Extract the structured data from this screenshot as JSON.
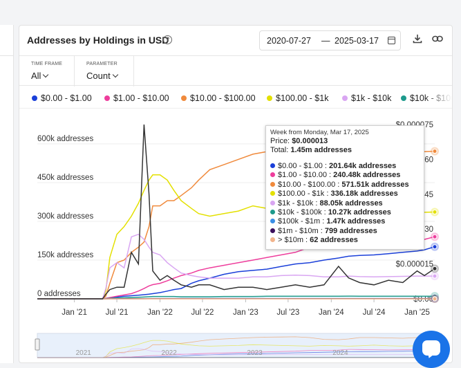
{
  "header": {
    "title": "Addresses by Holdings in USD",
    "help_icon": "?",
    "date_start": "2020-07-27",
    "date_sep": "—",
    "date_end": "2025-03-17",
    "icons": [
      "calendar-icon",
      "download-icon",
      "link-icon"
    ]
  },
  "controls": {
    "time_frame_label": "TIME FRAME",
    "time_frame_value": "All",
    "parameter_label": "PARAMETER",
    "parameter_value": "Count"
  },
  "tooltip": {
    "week": "Week from Monday, Mar 17, 2025",
    "price_label": "Price: ",
    "price_value": "$0.000013",
    "total_label": "Total: ",
    "total_value": "1.45m addresses",
    "rows": [
      {
        "label": "$0.00 - $1.00 : ",
        "value": "201.64k addresses",
        "color": "#1a3fd9"
      },
      {
        "label": "$1.00 - $10.00 : ",
        "value": "240.48k addresses",
        "color": "#ee3d9c"
      },
      {
        "label": "$10.00 - $100.00 : ",
        "value": "571.51k addresses",
        "color": "#f08a3c"
      },
      {
        "label": "$100.00 - $1k : ",
        "value": "336.18k addresses",
        "color": "#e3e000"
      },
      {
        "label": "$1k - $10k : ",
        "value": "88.05k addresses",
        "color": "#d9a6f2"
      },
      {
        "label": "$10k - $100k : ",
        "value": "10.27k addresses",
        "color": "#1d9a8c"
      },
      {
        "label": "$100k - $1m : ",
        "value": "1.47k addresses",
        "color": "#3a8fe6"
      },
      {
        "label": "$1m - $10m : ",
        "value": "799 addresses",
        "color": "#3c0f5c"
      },
      {
        "label": "> $10m : ",
        "value": "62 addresses",
        "color": "#f2b48c"
      }
    ]
  },
  "chart_data": {
    "type": "line",
    "xlabel": "",
    "ylabel": "",
    "x_tick_labels": [
      "Jan '21",
      "Jul '21",
      "Jan '22",
      "Jul '22",
      "Jan '23",
      "Jul '23",
      "Jan '24",
      "Jul '24",
      "Jan '25"
    ],
    "y_left_ticks": [
      "0 addresses",
      "150k addresses",
      "300k addresses",
      "450k addresses",
      "600k addresses"
    ],
    "y_left_range": [
      0,
      675000
    ],
    "y_right_ticks": [
      "$0.00",
      "$0.000015",
      "$0.000030",
      "$0.000045",
      "$0.000060",
      "$0.000075"
    ],
    "y_right_range": [
      0,
      7.5e-05
    ],
    "navigator_years": [
      "2021",
      "2022",
      "2023",
      "2024"
    ],
    "x": [
      "2020-07-27",
      "2021-01-01",
      "2021-05-01",
      "2021-05-15",
      "2021-06-01",
      "2021-07-01",
      "2021-08-01",
      "2021-09-01",
      "2021-10-01",
      "2021-10-25",
      "2021-11-15",
      "2021-12-01",
      "2022-01-01",
      "2022-02-01",
      "2022-03-01",
      "2022-04-01",
      "2022-05-15",
      "2022-06-15",
      "2022-08-01",
      "2022-10-01",
      "2022-12-01",
      "2023-02-01",
      "2023-04-01",
      "2023-06-01",
      "2023-08-01",
      "2023-10-01",
      "2023-12-01",
      "2024-02-01",
      "2024-03-15",
      "2024-05-01",
      "2024-07-01",
      "2024-09-01",
      "2024-11-01",
      "2025-01-01",
      "2025-02-01",
      "2025-03-17"
    ],
    "series": [
      {
        "name": "$0.00 - $1.00",
        "color": "#1a3fd9",
        "values": [
          0,
          0,
          0,
          2000,
          4000,
          7000,
          10000,
          12000,
          14000,
          16000,
          18000,
          20000,
          24000,
          30000,
          36000,
          40000,
          60000,
          70000,
          80000,
          95000,
          105000,
          110000,
          115000,
          125000,
          135000,
          140000,
          150000,
          158000,
          165000,
          168000,
          170000,
          175000,
          180000,
          185000,
          190000,
          201640
        ]
      },
      {
        "name": "$1.00 - $10.00",
        "color": "#ee3d9c",
        "values": [
          0,
          0,
          0,
          2000,
          5000,
          10000,
          15000,
          20000,
          30000,
          40000,
          50000,
          55000,
          60000,
          70000,
          80000,
          90000,
          100000,
          110000,
          120000,
          130000,
          140000,
          150000,
          160000,
          170000,
          180000,
          200000,
          200000,
          210000,
          230000,
          225000,
          220000,
          215000,
          220000,
          225000,
          230000,
          240480
        ]
      },
      {
        "name": "$10.00 - $100.00",
        "color": "#f08a3c",
        "values": [
          0,
          0,
          0,
          10000,
          60000,
          140000,
          150000,
          180000,
          200000,
          220000,
          280000,
          360000,
          360000,
          380000,
          380000,
          400000,
          430000,
          460000,
          500000,
          520000,
          540000,
          560000,
          570000,
          575000,
          580000,
          560000,
          510000,
          500000,
          520000,
          560000,
          560000,
          550000,
          540000,
          560000,
          570000,
          571510
        ]
      },
      {
        "name": "$100.00 - $1k",
        "color": "#e3e000",
        "values": [
          0,
          0,
          0,
          30000,
          160000,
          250000,
          280000,
          320000,
          370000,
          420000,
          460000,
          480000,
          480000,
          460000,
          420000,
          380000,
          350000,
          330000,
          320000,
          330000,
          340000,
          360000,
          350000,
          340000,
          330000,
          320000,
          340000,
          330000,
          320000,
          330000,
          350000,
          330000,
          320000,
          330000,
          335000,
          336180
        ]
      },
      {
        "name": "$1k - $10k",
        "color": "#d9a6f2",
        "values": [
          0,
          0,
          0,
          40000,
          120000,
          140000,
          120000,
          240000,
          250000,
          230000,
          200000,
          180000,
          170000,
          140000,
          120000,
          100000,
          90000,
          85000,
          80000,
          80000,
          80000,
          85000,
          85000,
          90000,
          92000,
          90000,
          85000,
          85000,
          88000,
          86000,
          85000,
          86000,
          87000,
          88000,
          88000,
          88050
        ]
      },
      {
        "name": "$10k - $100k",
        "color": "#1d9a8c",
        "values": [
          0,
          0,
          0,
          1000,
          2000,
          3000,
          4000,
          5000,
          6000,
          7000,
          8000,
          9000,
          9000,
          9000,
          9000,
          8000,
          8000,
          8000,
          8000,
          9000,
          9000,
          9000,
          10000,
          10000,
          10000,
          10000,
          10000,
          10000,
          10500,
          10200,
          10000,
          10100,
          10200,
          10250,
          10270,
          10270
        ]
      },
      {
        "name": "$100k - $1m",
        "color": "#3a8fe6",
        "values": [
          0,
          0,
          0,
          200,
          300,
          400,
          500,
          600,
          700,
          800,
          900,
          1000,
          1100,
          1150,
          1200,
          1250,
          1300,
          1300,
          1320,
          1350,
          1380,
          1400,
          1410,
          1420,
          1430,
          1440,
          1450,
          1450,
          1460,
          1460,
          1460,
          1465,
          1465,
          1468,
          1470,
          1470
        ]
      },
      {
        "name": "$1m - $10m",
        "color": "#3c0f5c",
        "values": [
          0,
          0,
          0,
          100,
          150,
          200,
          250,
          300,
          350,
          400,
          450,
          500,
          550,
          600,
          620,
          650,
          680,
          700,
          720,
          740,
          750,
          760,
          770,
          775,
          780,
          785,
          790,
          790,
          795,
          795,
          796,
          797,
          798,
          798,
          799,
          799
        ]
      },
      {
        "name": "> $10m",
        "color": "#f2b48c",
        "values": [
          0,
          0,
          0,
          5,
          10,
          15,
          20,
          25,
          30,
          35,
          40,
          45,
          48,
          50,
          52,
          54,
          55,
          56,
          57,
          58,
          59,
          60,
          60,
          61,
          61,
          61,
          62,
          62,
          62,
          62,
          62,
          62,
          62,
          62,
          62,
          62
        ]
      }
    ],
    "price_series": {
      "name": "Price",
      "color": "#333333",
      "values": [
        0,
        0,
        0,
        2e-06,
        4e-06,
        5e-06,
        5e-06,
        2e-05,
        1.5e-05,
        7.5e-05,
        4.5e-05,
        1.2e-05,
        8e-06,
        1e-05,
        8e-06,
        6e-06,
        5e-06,
        6e-06,
        6e-06,
        4e-06,
        5e-06,
        5e-06,
        4e-06,
        5e-06,
        6e-06,
        5e-06,
        6e-06,
        1.4e-05,
        9e-06,
        7e-06,
        6e-06,
        8e-06,
        7e-06,
        1.2e-05,
        1e-05,
        1.3e-05
      ]
    }
  }
}
